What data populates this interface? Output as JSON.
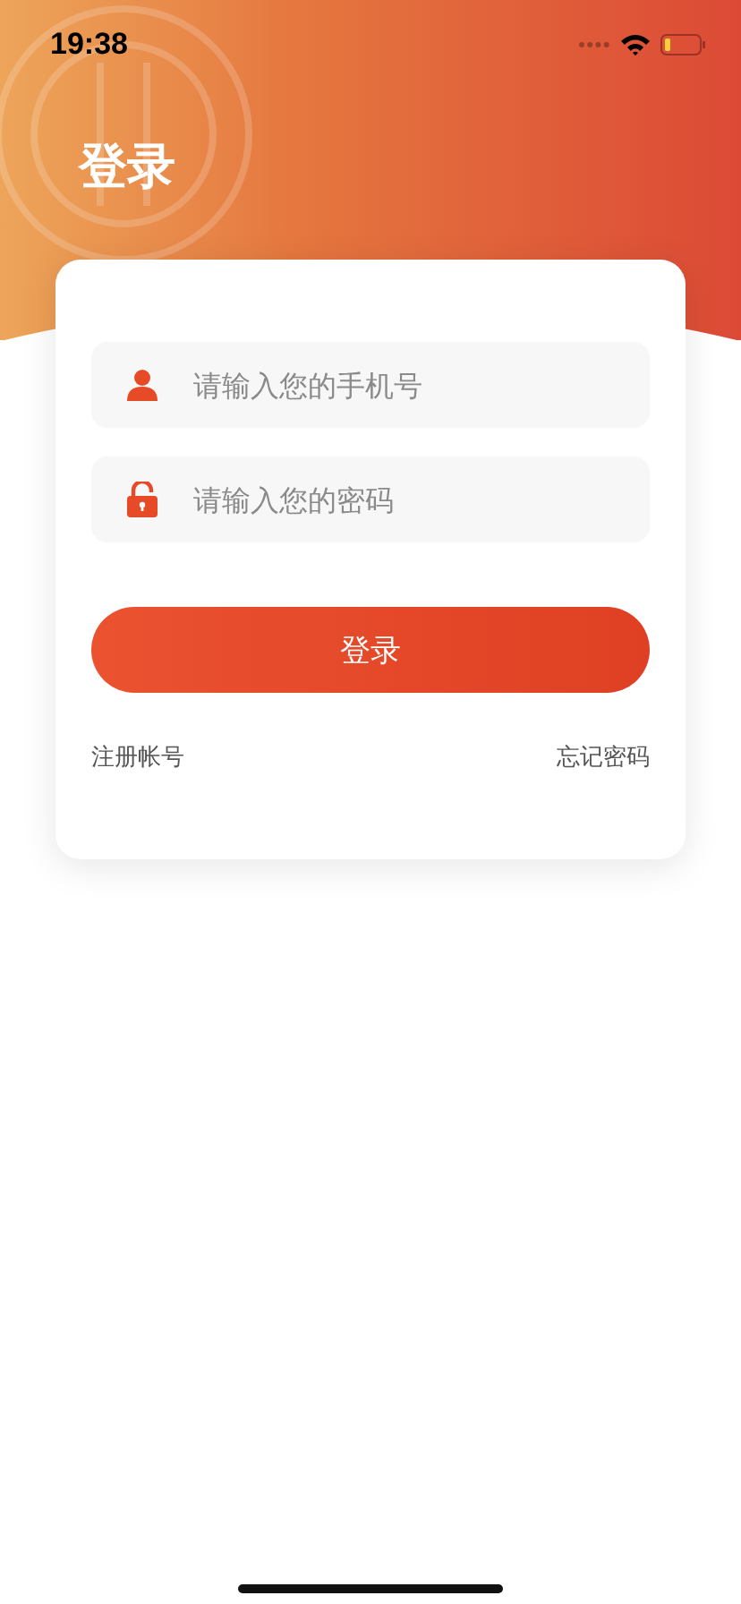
{
  "status_bar": {
    "time": "19:38"
  },
  "title": "登录",
  "fields": [
    {
      "kind": "phone",
      "placeholder": "请输入您的手机号"
    },
    {
      "kind": "password",
      "placeholder": "请输入您的密码"
    }
  ],
  "login_button": "登录",
  "links": [
    "注册帐号",
    "忘记密码"
  ]
}
